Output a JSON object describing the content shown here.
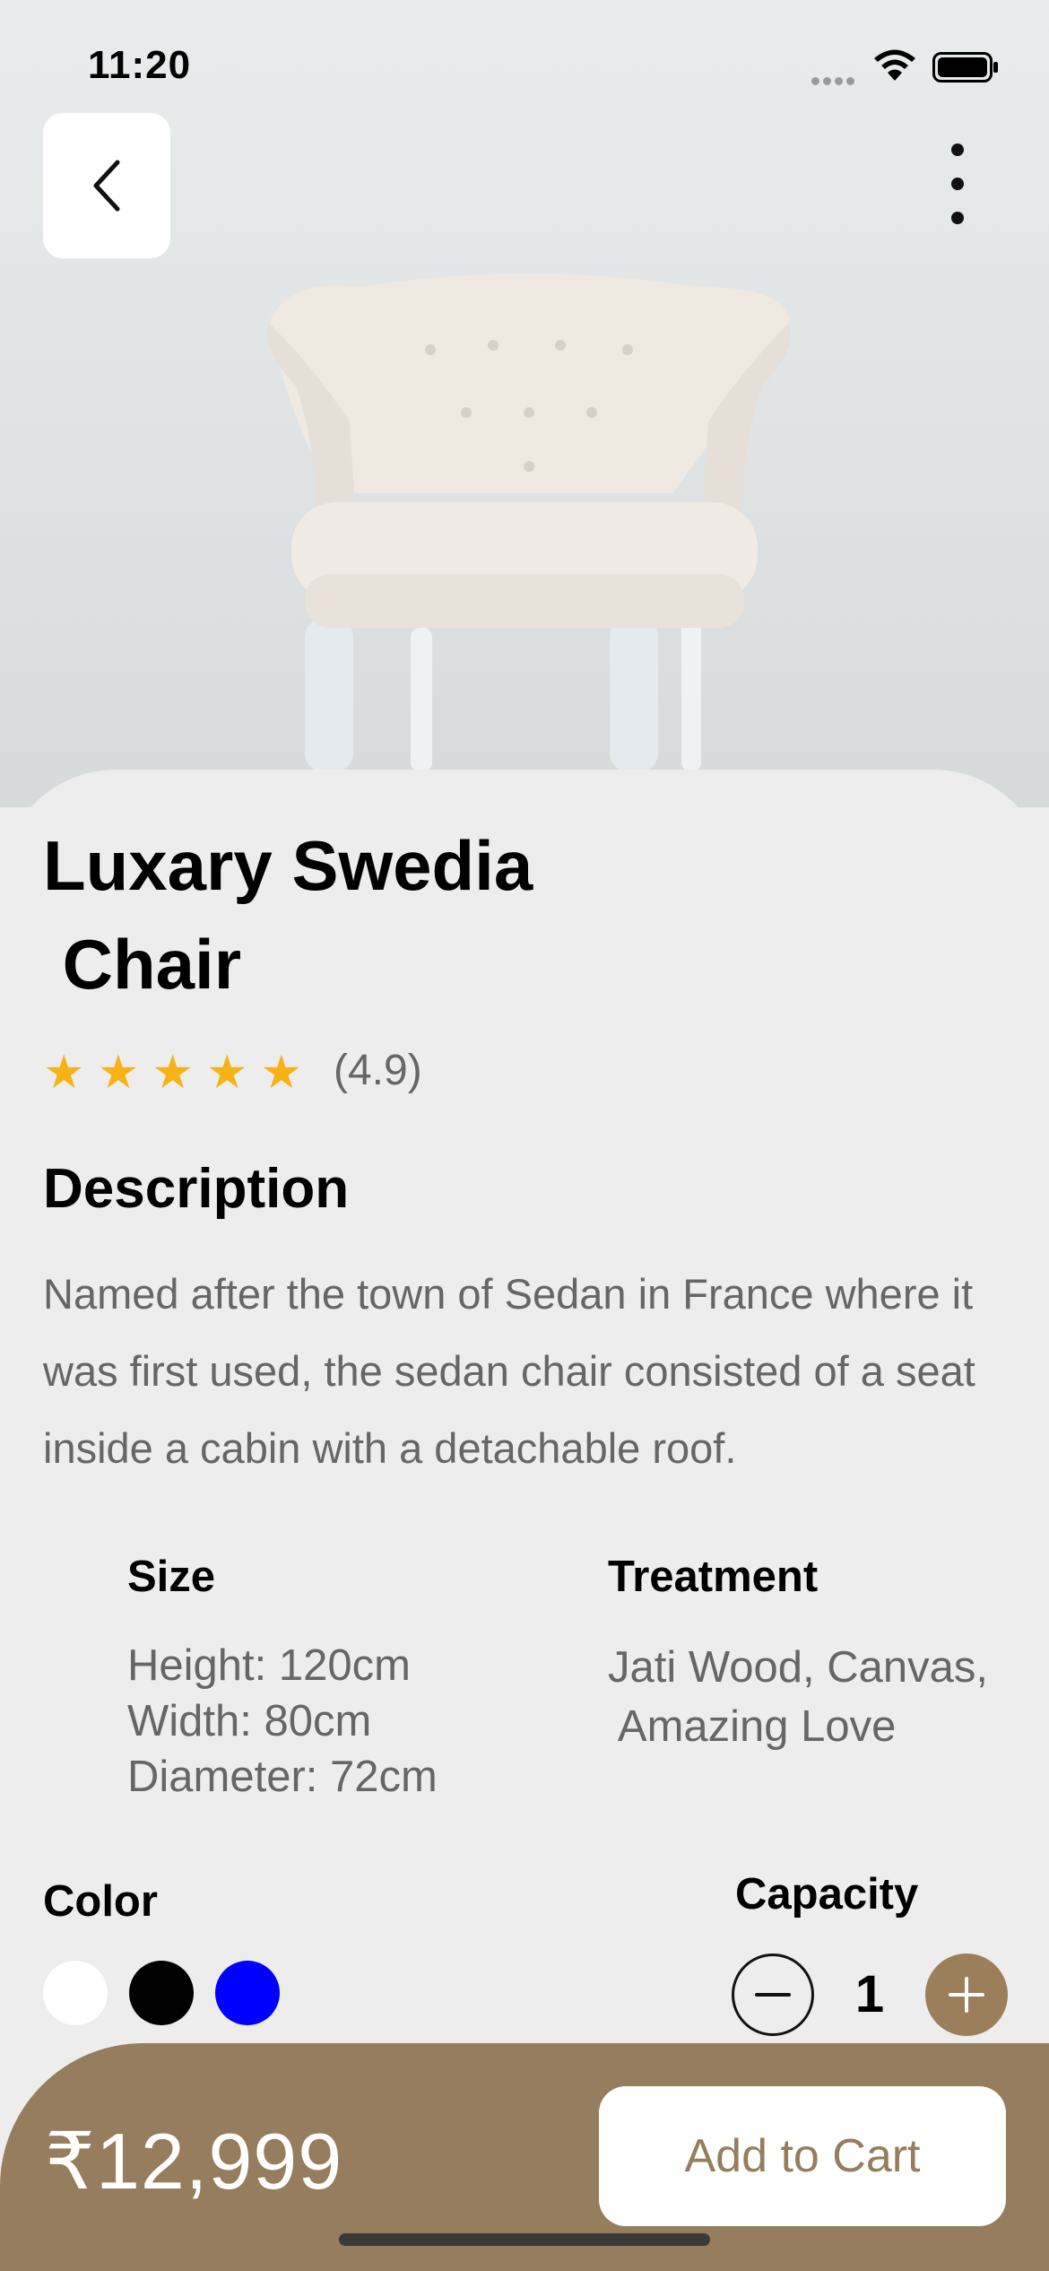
{
  "status_bar": {
    "time": "11:20"
  },
  "product": {
    "title": "Luxary Swedia\n Chair",
    "rating_stars": 5,
    "rating_text": "(4.9)"
  },
  "description": {
    "heading": "Description",
    "text": "Named after the town of Sedan in France where it was first used, the sedan chair consisted of a seat inside a cabin with a detachable roof."
  },
  "specs": {
    "size_heading": "Size",
    "size_lines": [
      "Height: 120cm",
      "Width: 80cm",
      "Diameter: 72cm"
    ],
    "treatment_heading": "Treatment",
    "treatment_text": "Jati Wood, Canvas,\n Amazing Love"
  },
  "color": {
    "heading": "Color",
    "swatches": [
      "#ffffff",
      "#000000",
      "#0000ff"
    ]
  },
  "capacity": {
    "heading": "Capacity",
    "quantity": "1"
  },
  "footer": {
    "price": "₹12,999",
    "add_to_cart_label": "Add to Cart"
  },
  "theme": {
    "accent": "#957d5d",
    "star": "#f6b317",
    "muted_text": "#666666",
    "background": "#ededed"
  },
  "icons": [
    "back-chevron-icon",
    "more-vertical-icon",
    "wifi-icon",
    "battery-icon",
    "star-icon",
    "minus-icon",
    "plus-icon"
  ]
}
